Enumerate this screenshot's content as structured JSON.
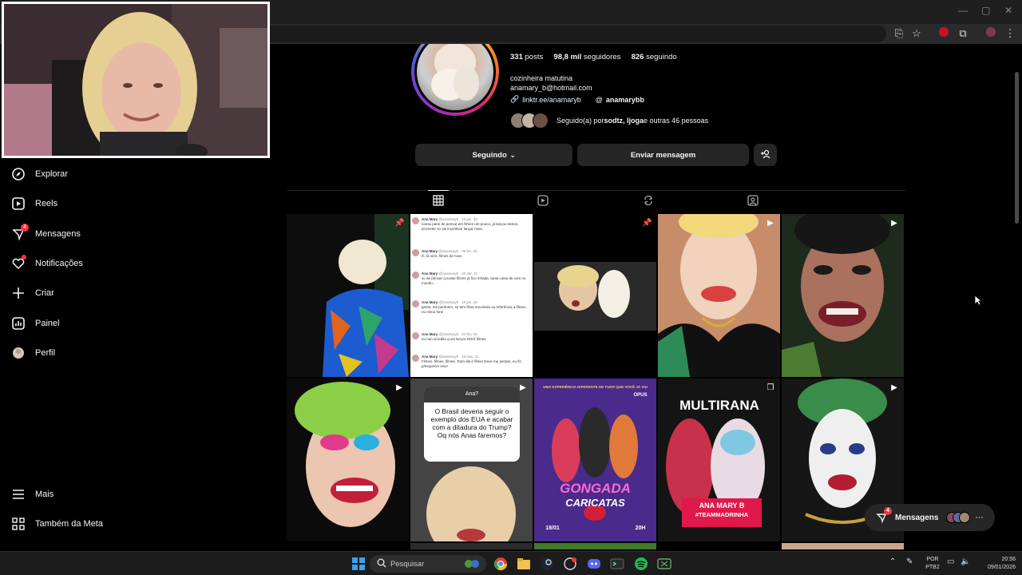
{
  "profile": {
    "posts_count": "331",
    "posts_label": "posts",
    "followers_count": "98,8 mil",
    "followers_label": "seguidores",
    "following_count": "826",
    "following_label": "seguindo",
    "bio_line1": "cozinheira matutina",
    "bio_email": "anamary_b@hotmail.com",
    "link": "linktr.ee/anamaryb",
    "threads_handle": "anamarybb",
    "followed_prefix": "Seguido(a) por ",
    "followed_names": "sodtz, ljoga",
    "followed_suffix": " e outras 46 pessoas"
  },
  "actions": {
    "following_btn": "Seguindo",
    "message_btn": "Enviar mensagem",
    "suggest_icon": "add-person-icon"
  },
  "sidebar": {
    "items": [
      {
        "label": "Explorar",
        "icon": "compass-icon"
      },
      {
        "label": "Reels",
        "icon": "reels-icon"
      },
      {
        "label": "Mensagens",
        "icon": "messenger-icon",
        "badge": "4"
      },
      {
        "label": "Notificações",
        "icon": "heart-icon"
      },
      {
        "label": "Criar",
        "icon": "plus-icon"
      },
      {
        "label": "Painel",
        "icon": "dashboard-icon"
      },
      {
        "label": "Perfil",
        "icon": "avatar"
      }
    ],
    "more": "Mais",
    "meta": "Também da Meta"
  },
  "grid": {
    "tweets": [
      {
        "name": "Ana Mary",
        "meta": "@anamaryb · 13 jan. 20",
        "text": "nossa parei de pensar em filmes um pouco, já lançou tantos, prometer so vai incentivar lançar mais."
      },
      {
        "name": "Ana Mary",
        "meta": "@anamaryb · 09 fev. 20",
        "text": "ih, lá vem, filmes de novo"
      },
      {
        "name": "Ana Mary",
        "meta": "@anamaryb · 20 abr. 21",
        "text": "so de pensar q existe filmes já fico irritada. tanta coisa de ruim no mundo..."
      },
      {
        "name": "Ana Mary",
        "meta": "@anamaryb · 18 jan. 20",
        "text": "gente, me perdoem, se tem filme envolvido ou referência a filmes, eu estou fora!"
      },
      {
        "name": "Ana Mary",
        "meta": "@anamaryb · 04 fev. 20",
        "text": "eu nao acredito q vai lançar DOIS filmes"
      },
      {
        "name": "Ana Mary",
        "meta": "@anamaryb · 16 mar. 21",
        "text": "Filmes, filmes, filmes. Todo dia é filme! Deus me perdoe, eu fiz, p/esquecer isso!"
      }
    ],
    "question_head": "Ana?",
    "question_text": "O Brasil deveria seguir o exemplo dos EUA e acabar com a ditadura do Trump? Oq nós Anas faremos?",
    "poster1_top": "UMA EXPERIÊNCIA DIFERENTE DE TUDO QUE VOCÊ JÁ VIU",
    "poster1_brand": "OPUS",
    "poster1_title": "GONGADA",
    "poster1_sub": "CARICATAS",
    "poster1_date": "18/01",
    "poster1_time": "20H",
    "poster2_title": "MULTIRANA",
    "poster2_name": "ANA MARY B",
    "poster2_tag": "#TEAMMADRINHA"
  },
  "messages_pill": {
    "label": "Mensagens",
    "badge": "4"
  },
  "taskbar": {
    "search": "Pesquisar",
    "lang1": "POR",
    "lang2": "PTB2",
    "time": "20:56",
    "date": "09/01/2026"
  },
  "colors": {
    "background": "#000000",
    "button": "#262626",
    "badge": "#ff3040",
    "link": "#e0f1ff"
  }
}
